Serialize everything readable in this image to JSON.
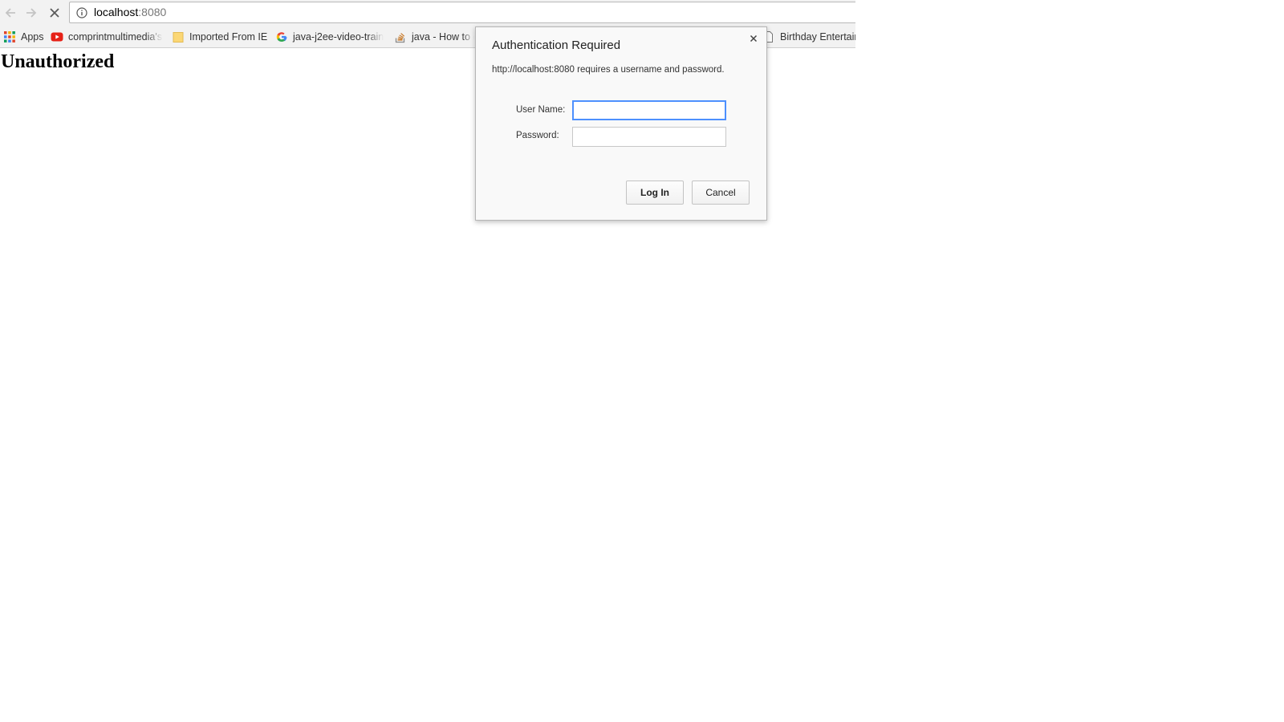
{
  "browser": {
    "url_host": "localhost",
    "url_port": ":8080",
    "bookmarks": [
      {
        "label": "Apps",
        "icon": "apps-grid-icon"
      },
      {
        "label": "comprintmultimedia's",
        "icon": "youtube-icon"
      },
      {
        "label": "Imported From IE",
        "icon": "folder-icon"
      },
      {
        "label": "java-j2ee-video-traini",
        "icon": "google-icon"
      },
      {
        "label": "java - How to d",
        "icon": "stackoverflow-icon"
      },
      {
        "label": "Birthday Entertain",
        "icon": "page-icon"
      }
    ]
  },
  "page": {
    "heading": "Unauthorized"
  },
  "dialog": {
    "title": "Authentication Required",
    "message": "http://localhost:8080 requires a username and password.",
    "username_label": "User Name:",
    "password_label": "Password:",
    "username_value": "",
    "password_value": "",
    "login_button": "Log In",
    "cancel_button": "Cancel"
  },
  "colors": {
    "focus_ring": "#4d90fe",
    "youtube_red": "#e62117",
    "apps_grid": "#e0442b"
  }
}
